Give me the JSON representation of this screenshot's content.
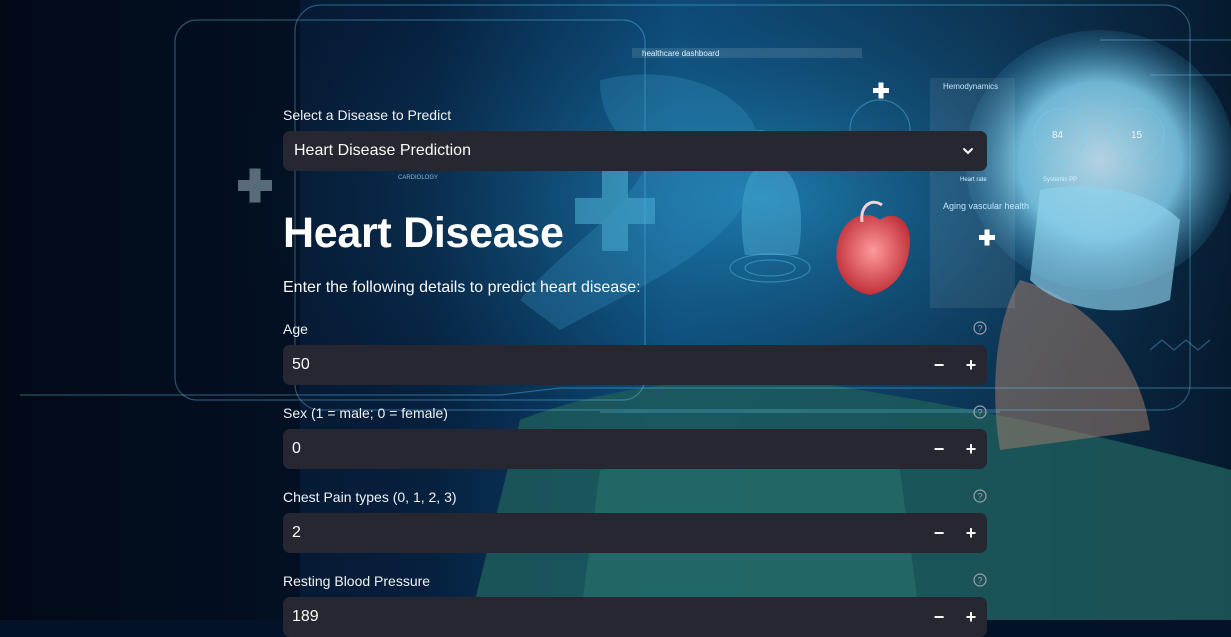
{
  "disease_selector": {
    "label": "Select a Disease to Predict",
    "selected": "Heart Disease Prediction"
  },
  "page": {
    "title": "Heart Disease",
    "subtitle": "Enter the following details to predict heart disease:"
  },
  "fields": [
    {
      "label": "Age",
      "value": "50"
    },
    {
      "label": "Sex (1 = male; 0 = female)",
      "value": "0"
    },
    {
      "label": "Chest Pain types (0, 1, 2, 3)",
      "value": "2"
    },
    {
      "label": "Resting Blood Pressure",
      "value": "189"
    }
  ],
  "background": {
    "dashboard_label": "healthcare dashboard",
    "hemodynamics": "Hemodynamics",
    "aging": "Aging vascular health",
    "cardiology": "CARDIOLOGY",
    "heart_rate": "Heart rate",
    "systemic": "Systemic PP",
    "gauge1": "84",
    "gauge2": "15"
  },
  "icons": {
    "dropdown": "chevron-down-icon",
    "help": "help-circle-icon",
    "minus": "minus-icon",
    "plus": "plus-icon"
  }
}
